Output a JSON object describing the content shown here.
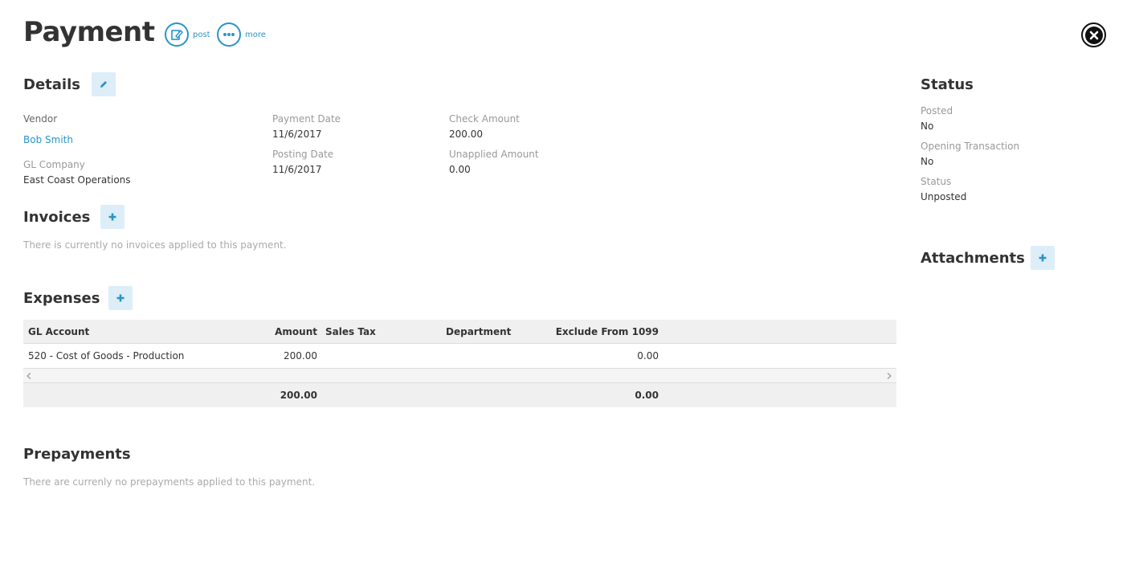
{
  "header": {
    "title": "Payment",
    "actions": [
      {
        "label": "post",
        "icon": "edit-icon"
      },
      {
        "label": "more",
        "icon": "more-icon"
      }
    ],
    "close_icon": "close-icon"
  },
  "details": {
    "title": "Details",
    "vendor_label": "Vendor",
    "vendor_value": "Bob Smith",
    "gl_company_label": "GL Company",
    "gl_company_value": "East Coast Operations",
    "payment_date_label": "Payment Date",
    "payment_date_value": "11/6/2017",
    "posting_date_label": "Posting Date",
    "posting_date_value": "11/6/2017",
    "check_amount_label": "Check Amount",
    "check_amount_value": "200.00",
    "unapplied_amount_label": "Unapplied Amount",
    "unapplied_amount_value": "0.00"
  },
  "invoices": {
    "title": "Invoices",
    "empty_text": "There is currently no invoices applied to this payment."
  },
  "expenses": {
    "title": "Expenses",
    "columns": [
      "GL Account",
      "Amount",
      "Sales Tax",
      "Department",
      "Exclude From 1099"
    ],
    "rows": [
      {
        "gl_account": "520 - Cost of Goods - Production",
        "amount": "200.00",
        "sales_tax": "",
        "department": "",
        "exclude_1099": "0.00"
      }
    ],
    "totals": {
      "amount": "200.00",
      "exclude_1099": "0.00"
    }
  },
  "prepayments": {
    "title": "Prepayments",
    "empty_text": "There are currenly no prepayments applied to this payment."
  },
  "status": {
    "title": "Status",
    "posted_label": "Posted",
    "posted_value": "No",
    "opening_label": "Opening Transaction",
    "opening_value": "No",
    "status_label": "Status",
    "status_value": "Unposted"
  },
  "attachments": {
    "title": "Attachments"
  },
  "colors": {
    "accent": "#2a94c9",
    "button_bg": "#ddeef8",
    "table_header_bg": "#f0f0f0"
  }
}
